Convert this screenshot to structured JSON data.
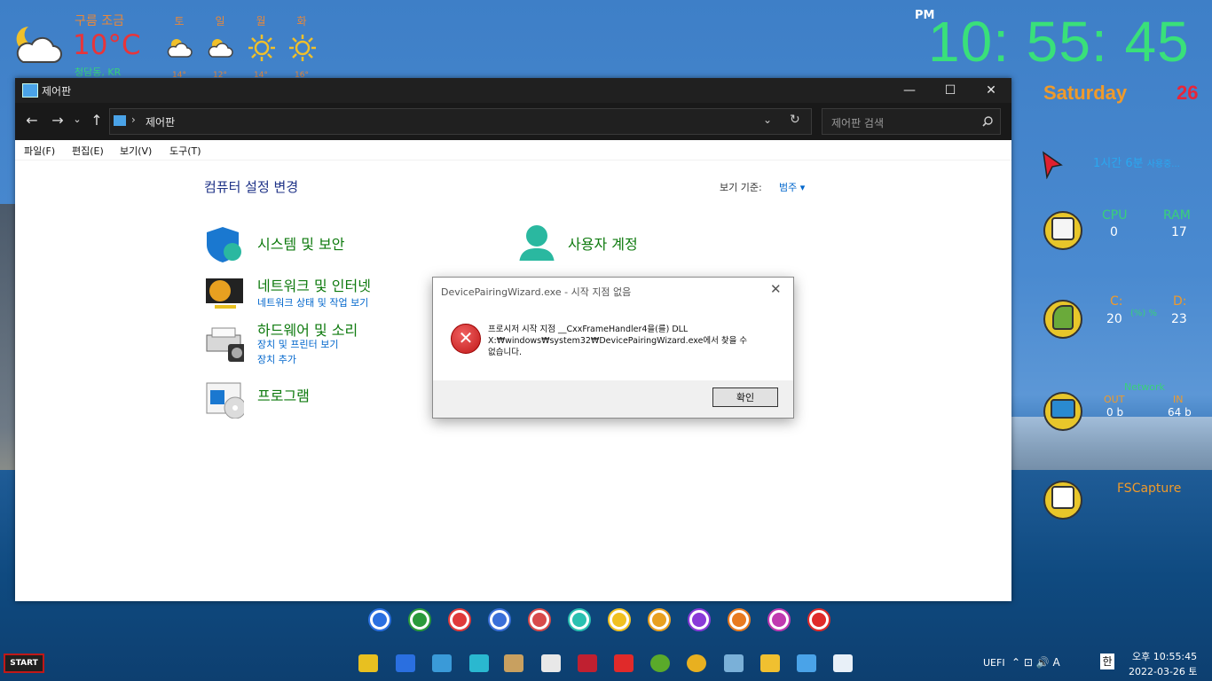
{
  "weather": {
    "condition": "구름 조금",
    "temp": "10°C",
    "location": "청담동, KR",
    "icon": "partly-cloudy-night-icon",
    "forecast": [
      {
        "day": "토",
        "temp": "14°",
        "icon": "partly-cloudy-icon"
      },
      {
        "day": "일",
        "temp": "12°",
        "icon": "partly-cloudy-icon"
      },
      {
        "day": "월",
        "temp": "14°",
        "icon": "sun-icon"
      },
      {
        "day": "화",
        "temp": "16°",
        "icon": "sun-icon"
      }
    ]
  },
  "clock": {
    "ampm": "PM",
    "time": "10: 55: 45",
    "weekday": "Saturday",
    "day": "26"
  },
  "uptime": {
    "main": "1시간 6분",
    "suffix": "사용중..."
  },
  "cpu_ram": {
    "cpu_label": "CPU",
    "ram_label": "RAM",
    "cpu": "0",
    "ram": "17"
  },
  "disk": {
    "c_label": "C:",
    "d_label": "D:",
    "c": "20",
    "d": "23",
    "middle": "(%) %"
  },
  "network": {
    "title": "Network",
    "out_label": "OUT",
    "in_label": "IN",
    "out": "0 b",
    "in": "64 b"
  },
  "fscapture": {
    "label": "FSCapture"
  },
  "window": {
    "title": "제어판",
    "controls": {
      "minimize": "—",
      "maximize": "☐",
      "close": "✕"
    },
    "nav": {
      "back": "←",
      "forward": "→",
      "recent": "⌄",
      "up": "↑"
    },
    "address": "제어판",
    "address_sep": "›",
    "search_placeholder": "제어판 검색",
    "menu": [
      "파일(F)",
      "편집(E)",
      "보기(V)",
      "도구(T)"
    ],
    "heading": "컴퓨터 설정 변경",
    "view_by_label": "보기 기준:",
    "view_by_value": "범주 ▾",
    "categories": [
      {
        "title": "시스템 및 보안",
        "links": []
      },
      {
        "title": "네트워크 및 인터넷",
        "links": [
          "네트워크 상태 및 작업 보기"
        ]
      },
      {
        "title": "하드웨어 및 소리",
        "links": [
          "장치 및 프린터 보기",
          "장치 추가"
        ]
      },
      {
        "title": "프로그램",
        "links": []
      },
      {
        "title": "사용자 계정",
        "links": []
      }
    ]
  },
  "dialog": {
    "title": "DevicePairingWizard.exe - 시작 지점 없음",
    "close": "✕",
    "icon_glyph": "✕",
    "message_line1": "프로시저 시작 지점 __CxxFrameHandler4을(를) DLL",
    "message_line2": "X:₩windows₩system32₩DevicePairingWizard.exe에서 찾을 수",
    "message_line3": "없습니다.",
    "ok": "확인"
  },
  "colors": {
    "dock": [
      "#2a6fe0",
      "#2a9a3a",
      "#e03a3a",
      "#3a6fd8",
      "#d84a4a",
      "#2ac0b0",
      "#f0c020",
      "#e8a020",
      "#8a3ad8",
      "#e87a20",
      "#c03ab0",
      "#e02a2a"
    ]
  },
  "taskbar": {
    "start": "START",
    "uefi": "UEFI",
    "tray_symbols": "⌃  ⊡  🔊  A",
    "ime": "한",
    "time": "오후 10:55:45",
    "date": "2022-03-26 토"
  }
}
